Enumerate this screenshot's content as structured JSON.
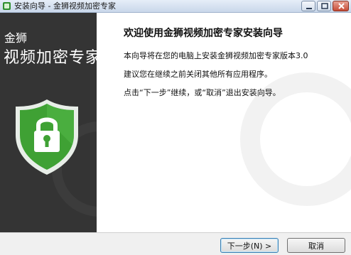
{
  "window": {
    "title": "安装向导 - 金狮视频加密专家"
  },
  "sidebar": {
    "brand": "金狮",
    "product": "视频加密专家"
  },
  "content": {
    "heading": "欢迎使用金狮视频加密专家安装向导",
    "paragraph1": "本向导将在您的电脑上安装金狮视频加密专家版本3.0",
    "paragraph2": "建议您在继续之前关闭其他所有应用程序。",
    "paragraph3": "点击“下一步”继续，或“取消”退出安装向导。"
  },
  "buttons": {
    "next_label": "下一步(N) >",
    "cancel_label": "取消"
  },
  "colors": {
    "sidebar_bg": "#343434",
    "shield_green": "#3fa134",
    "close_red": "#c74c36"
  },
  "icons": {
    "app": "app-icon",
    "shield": "shield-lock-icon"
  }
}
